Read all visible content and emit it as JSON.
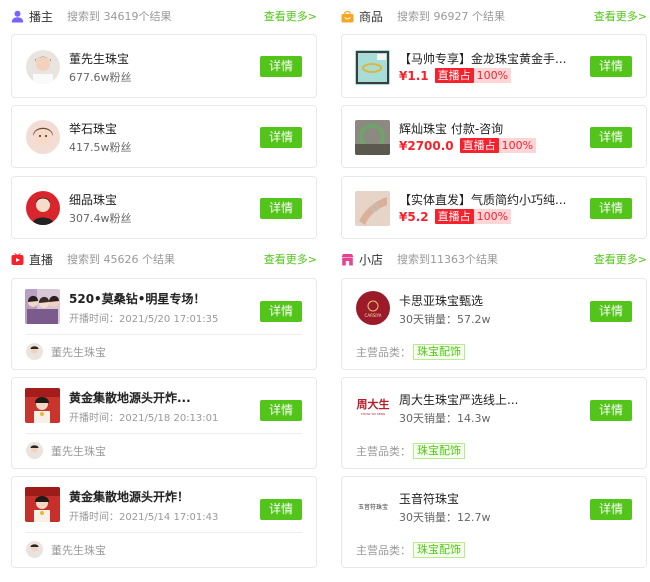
{
  "anchors": {
    "title": "播主",
    "count": "搜索到 34619个结果",
    "more": "查看更多>",
    "items": [
      {
        "name": "董先生珠宝",
        "fans": "677.6w粉丝",
        "button": "详情"
      },
      {
        "name": "举石珠宝",
        "fans": "417.5w粉丝",
        "button": "详情"
      },
      {
        "name": "细品珠宝",
        "fans": "307.4w粉丝",
        "button": "详情"
      }
    ]
  },
  "products": {
    "title": "商品",
    "count": "搜索到 96927 个结果",
    "more": "查看更多>",
    "items": [
      {
        "name": "【马帅专享】金龙珠宝黄金手...",
        "price": "¥1.1",
        "tag": "直播占",
        "pct": "100%",
        "button": "详情"
      },
      {
        "name": "辉灿珠宝 付款-咨询",
        "price": "¥2700.0",
        "tag": "直播占",
        "pct": "100%",
        "button": "详情"
      },
      {
        "name": "【实体直发】气质简约小巧纯...",
        "price": "¥5.2",
        "tag": "直播占",
        "pct": "100%",
        "button": "详情"
      }
    ]
  },
  "lives": {
    "title": "直播",
    "count": "搜索到 45626 个结果",
    "more": "查看更多>",
    "items": [
      {
        "title": "520•莫桑钻•明星专场！",
        "time": "开播时间：2021/5/20 17:01:35",
        "host": "董先生珠宝",
        "button": "详情"
      },
      {
        "title": "黄金集散地源头开炸...",
        "time": "开播时间：2021/5/18 20:13:01",
        "host": "董先生珠宝",
        "button": "详情"
      },
      {
        "title": "黄金集散地源头开炸！",
        "time": "开播时间：2021/5/14 17:01:43",
        "host": "董先生珠宝",
        "button": "详情"
      }
    ]
  },
  "shops": {
    "title": "小店",
    "count": "搜索到11363个结果",
    "more": "查看更多>",
    "category_label": "主营品类：",
    "items": [
      {
        "name": "卡思亚珠宝甄选",
        "sales": "30天销量：57.2w",
        "category": "珠宝配饰",
        "button": "详情",
        "logo_text": "CARSIYA"
      },
      {
        "name": "周大生珠宝严选线上...",
        "sales": "30天销量：14.3w",
        "category": "珠宝配饰",
        "button": "详情",
        "logo_text": "周大生",
        "logo_sub": "CHOW TAI SENG"
      },
      {
        "name": "玉音符珠宝",
        "sales": "30天销量：12.7w",
        "category": "珠宝配饰",
        "button": "详情",
        "logo_text": "玉音符珠宝"
      }
    ]
  },
  "colors": {
    "accent_green": "#52c41a",
    "price_red": "#f5222d",
    "anchor_icon": "#7b61ff",
    "product_icon": "#f5a623",
    "live_icon": "#f5222d",
    "shop_icon": "#e84393"
  },
  "icons": {
    "anchor": "user-icon",
    "product": "bag-icon",
    "live": "tv-icon",
    "shop": "store-icon"
  }
}
